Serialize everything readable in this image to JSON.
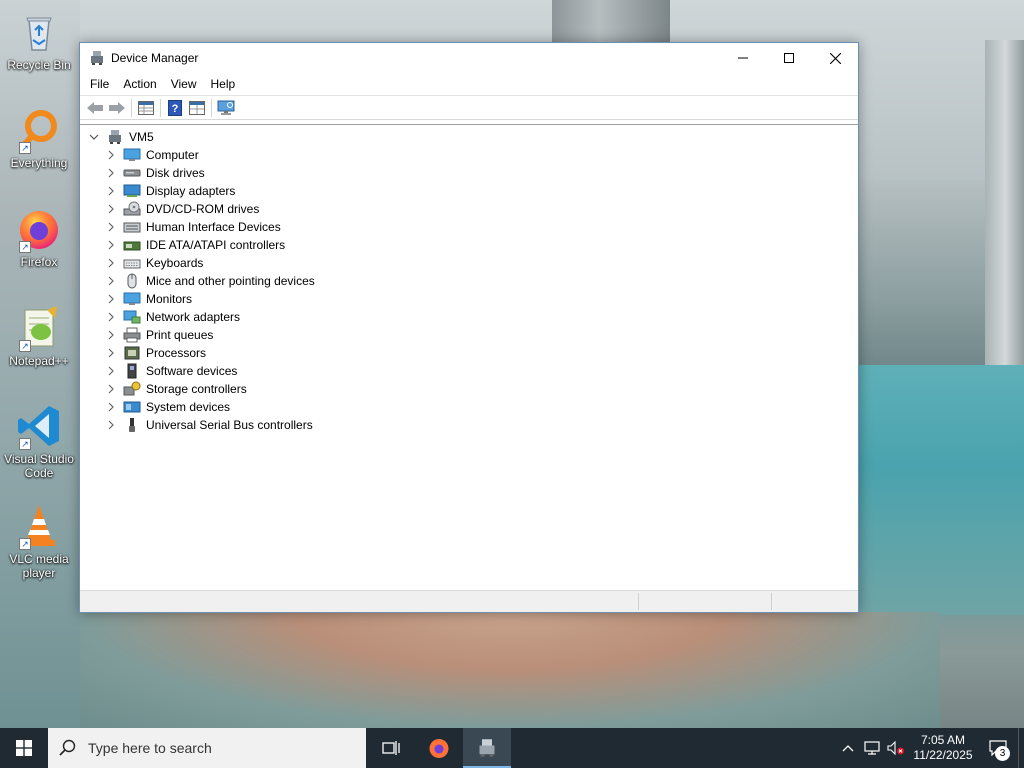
{
  "desktop": {
    "icons": [
      {
        "label": "Recycle Bin",
        "icon": "recycle-bin-icon"
      },
      {
        "label": "Everything",
        "icon": "everything-search-icon"
      },
      {
        "label": "Firefox",
        "icon": "firefox-icon"
      },
      {
        "label": "Notepad++",
        "icon": "notepad-plus-plus-icon"
      },
      {
        "label": "Visual Studio Code",
        "icon": "vscode-icon"
      },
      {
        "label": "VLC media player",
        "icon": "vlc-icon"
      }
    ]
  },
  "window": {
    "title": "Device Manager",
    "menu": [
      "File",
      "Action",
      "View",
      "Help"
    ],
    "toolbar": [
      "back-arrow-icon",
      "forward-arrow-icon",
      "properties-grid-icon",
      "help-icon",
      "show-hidden-icon",
      "scan-hardware-icon"
    ],
    "tree": {
      "root": "VM5",
      "categories": [
        {
          "label": "Computer",
          "icon": "computer-icon"
        },
        {
          "label": "Disk drives",
          "icon": "disk-drive-icon"
        },
        {
          "label": "Display adapters",
          "icon": "display-adapter-icon"
        },
        {
          "label": "DVD/CD-ROM drives",
          "icon": "dvd-drive-icon"
        },
        {
          "label": "Human Interface Devices",
          "icon": "hid-icon"
        },
        {
          "label": "IDE ATA/ATAPI controllers",
          "icon": "ide-controller-icon"
        },
        {
          "label": "Keyboards",
          "icon": "keyboard-icon"
        },
        {
          "label": "Mice and other pointing devices",
          "icon": "mouse-icon"
        },
        {
          "label": "Monitors",
          "icon": "monitor-icon"
        },
        {
          "label": "Network adapters",
          "icon": "network-adapter-icon"
        },
        {
          "label": "Print queues",
          "icon": "printer-icon"
        },
        {
          "label": "Processors",
          "icon": "processor-icon"
        },
        {
          "label": "Software devices",
          "icon": "software-device-icon"
        },
        {
          "label": "Storage controllers",
          "icon": "storage-controller-icon"
        },
        {
          "label": "System devices",
          "icon": "system-devices-icon"
        },
        {
          "label": "Universal Serial Bus controllers",
          "icon": "usb-icon"
        }
      ]
    }
  },
  "taskbar": {
    "search_placeholder": "Type here to search",
    "time": "7:05 AM",
    "date": "11/22/2025",
    "notification_count": "3"
  },
  "colors": {
    "accent": "#1a73c8",
    "taskbar": "#1f2a33"
  }
}
